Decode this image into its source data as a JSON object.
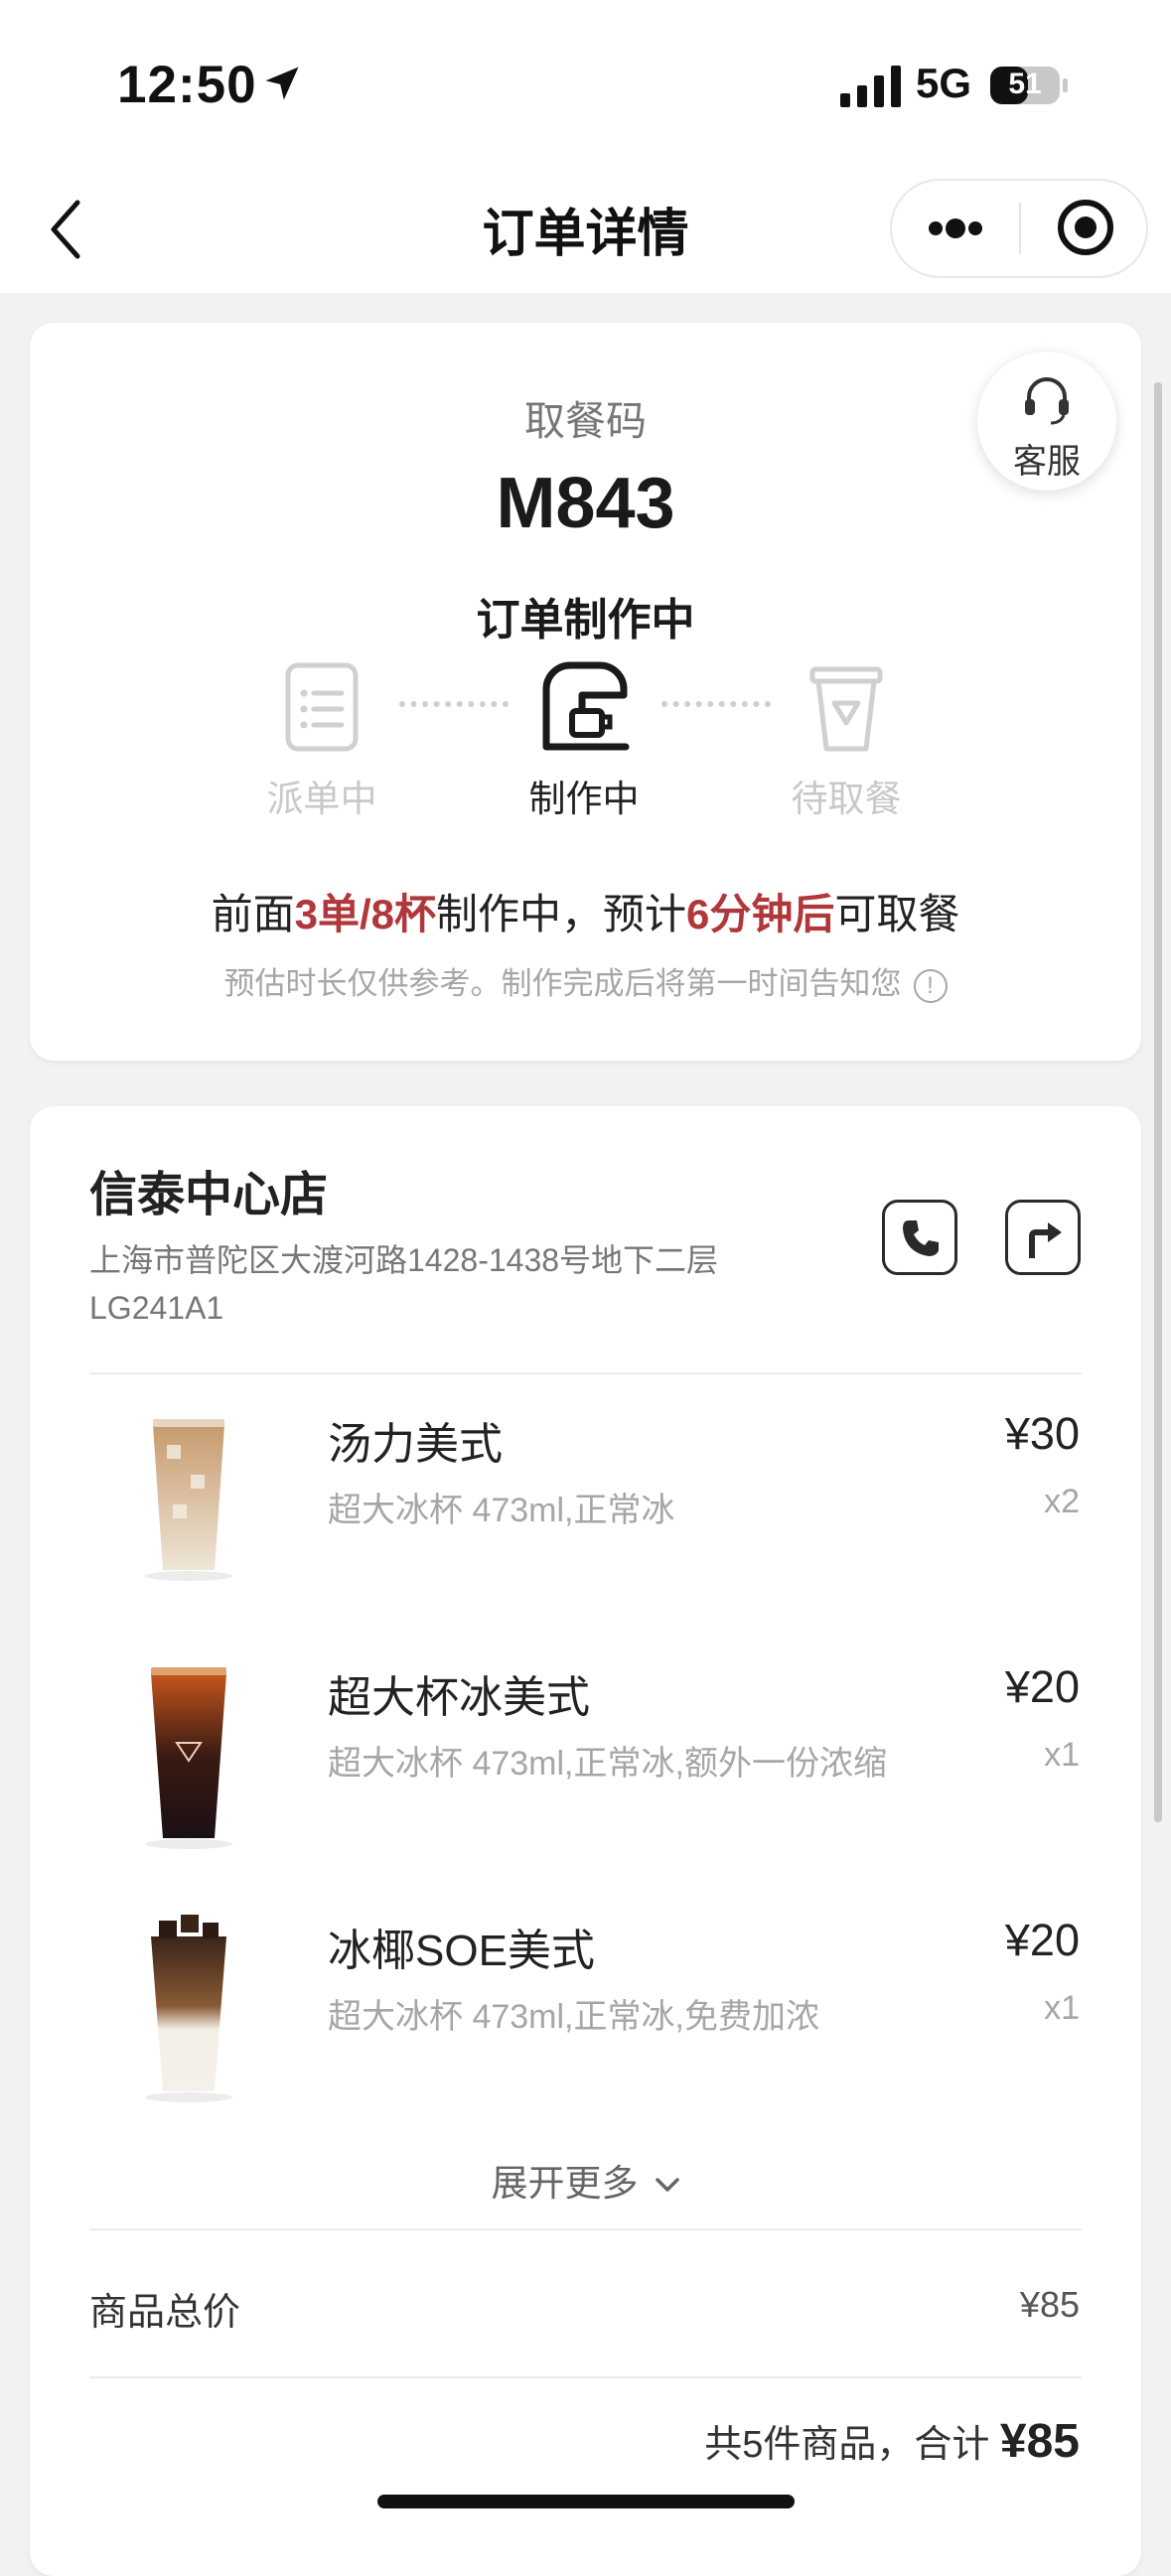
{
  "status_bar": {
    "time": "12:50",
    "network": "5G",
    "battery": "51"
  },
  "nav": {
    "title": "订单详情"
  },
  "pickup": {
    "label": "取餐码",
    "code": "M843",
    "status": "订单制作中"
  },
  "customer_service": {
    "label": "客服"
  },
  "progress": {
    "steps": [
      {
        "label": "派单中",
        "state": "done"
      },
      {
        "label": "制作中",
        "state": "active"
      },
      {
        "label": "待取餐",
        "state": "pending"
      }
    ]
  },
  "queue": {
    "prefix": "前面",
    "count": "3单/8杯",
    "middle": "制作中，预计",
    "eta": "6分钟后",
    "suffix": "可取餐",
    "disclaimer": "预估时长仅供参考。制作完成后将第一时间告知您"
  },
  "store": {
    "name": "信泰中心店",
    "address": "上海市普陀区大渡河路1428-1438号地下二层LG241A1"
  },
  "products": [
    {
      "name": "汤力美式",
      "spec": "超大冰杯 473ml,正常冰",
      "price": "¥30",
      "qty": "x2"
    },
    {
      "name": "超大杯冰美式",
      "spec": "超大冰杯 473ml,正常冰,额外一份浓缩",
      "price": "¥20",
      "qty": "x1"
    },
    {
      "name": "冰椰SOE美式",
      "spec": "超大冰杯 473ml,正常冰,免费加浓",
      "price": "¥20",
      "qty": "x1"
    }
  ],
  "expand_label": "展开更多",
  "totals": {
    "label": "商品总价",
    "value": "¥85",
    "summary_text": "共5件商品，合计",
    "summary_amount": "¥85"
  },
  "colors": {
    "accent_red": "#b0373a",
    "muted": "#a6a6a6"
  }
}
